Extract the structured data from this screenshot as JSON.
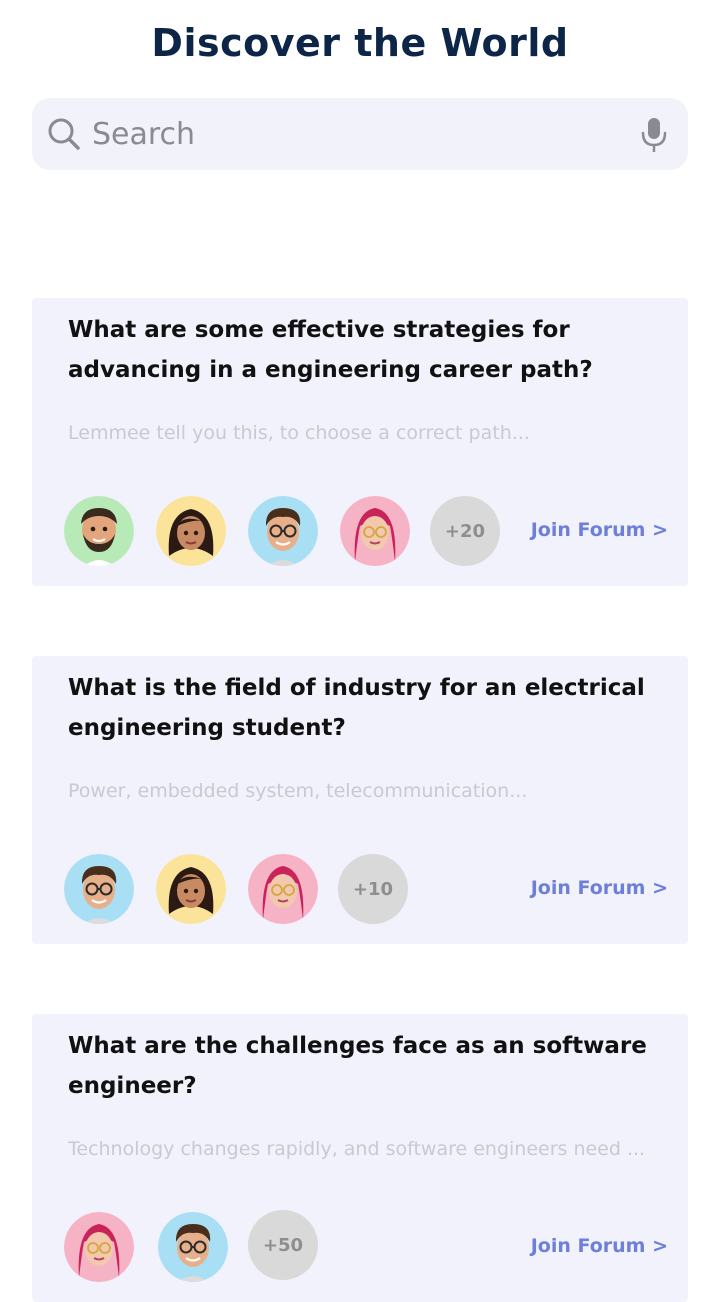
{
  "header": {
    "title": "Discover the World"
  },
  "search": {
    "placeholder": "Search",
    "value": ""
  },
  "icons": {
    "search": "search-icon",
    "mic": "microphone-icon"
  },
  "colors": {
    "title": "#0d2547",
    "card_background": "#f2f2fc",
    "link": "#6d7fd8",
    "excerpt": "#c9c9d2"
  },
  "forums": [
    {
      "question": "What are some effective strategies for advancing in a engineering career path?",
      "excerpt": "Lemmee tell you this, to choose a correct path...",
      "avatars": [
        "man-beard-avatar",
        "woman-dark-hair-avatar",
        "man-glasses-avatar",
        "woman-pink-hair-avatar"
      ],
      "more_count": "+20",
      "join_label": "Join Forum >"
    },
    {
      "question": "What is the field of industry for an electrical engineering student?",
      "excerpt": "Power, embedded system, telecommunication...",
      "avatars": [
        "man-glasses-avatar",
        "woman-dark-hair-avatar",
        "woman-pink-hair-avatar"
      ],
      "more_count": "+10",
      "join_label": "Join Forum >"
    },
    {
      "question": "What are the challenges face as an software engineer?",
      "excerpt": "Technology changes rapidly, and software engineers need ...",
      "avatars": [
        "woman-pink-hair-avatar",
        "man-glasses-avatar"
      ],
      "more_count": "+50",
      "join_label": "Join Forum >"
    }
  ]
}
